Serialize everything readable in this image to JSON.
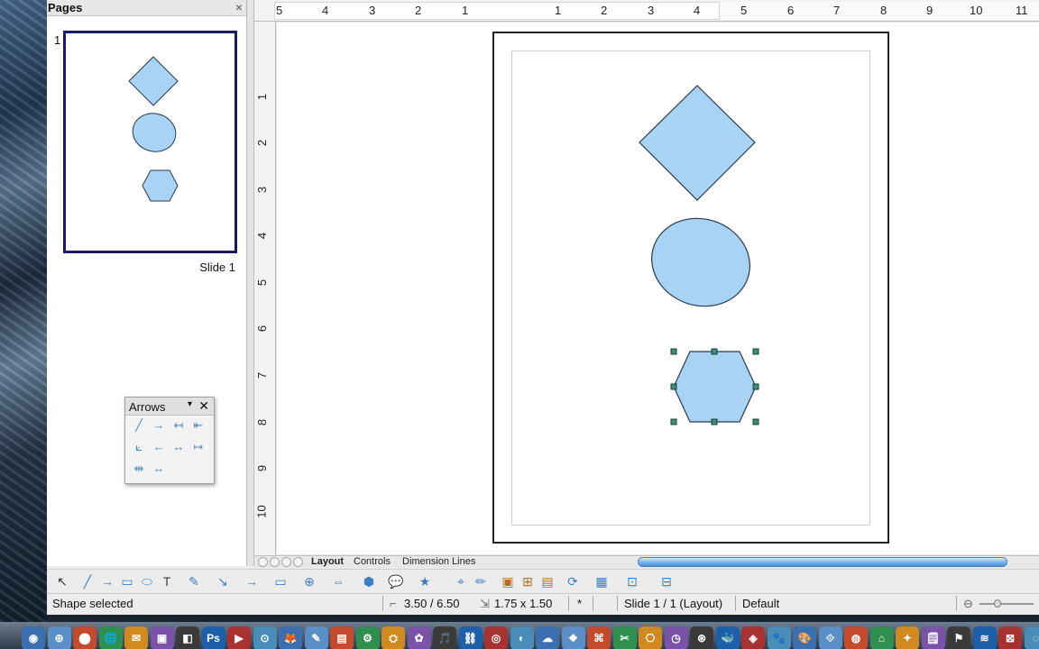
{
  "pages_panel": {
    "title": "Pages",
    "close": "×",
    "slide_number": "1",
    "slide_label": "Slide 1"
  },
  "rulers": {
    "horizontal": [
      "5",
      "4",
      "3",
      "2",
      "1",
      "1",
      "2",
      "3",
      "4",
      "5",
      "6",
      "7",
      "8",
      "9",
      "10",
      "11"
    ],
    "vertical": [
      "1",
      "2",
      "3",
      "4",
      "5",
      "6",
      "7",
      "8",
      "9",
      "10"
    ]
  },
  "tabs": [
    {
      "label": "Layout",
      "active": true
    },
    {
      "label": "Controls",
      "active": false
    },
    {
      "label": "Dimension Lines",
      "active": false
    }
  ],
  "arrows_toolbar": {
    "title": "Arrows",
    "menu": "▾",
    "close": "✕",
    "items": [
      "╱",
      "→",
      "↤",
      "⇤",
      "⟀",
      "←",
      "↔",
      "↦",
      "⇹",
      "↔"
    ]
  },
  "toolbar": {
    "items": [
      "↖",
      "╱",
      "→",
      "▭",
      "⬭",
      "T",
      "✎",
      "↘",
      "→",
      "▭",
      "⊕",
      "⇔",
      "⬢",
      "💬",
      "★",
      "⌖",
      "✏",
      "▣",
      "⊞",
      "▤",
      "⟳",
      "▦",
      "⊡",
      "⊟"
    ]
  },
  "status": {
    "message": "Shape selected",
    "position": "3.50 / 6.50",
    "size": "1.75 x 1.50",
    "modified": "*",
    "slide": "Slide 1 / 1 (Layout)",
    "master": "Default"
  },
  "colors": {
    "shape_fill": "#a9d3f5",
    "shape_stroke": "#2a3a4a",
    "thumb_border": "#1a1a66",
    "scroll": "#4a8fd8"
  },
  "dock": {
    "items": [
      "◉",
      "⊕",
      "⬤",
      "🌐",
      "✉",
      "▣",
      "◧",
      "Ps",
      "▶",
      "⊙",
      "🦊",
      "✎",
      "▤",
      "⚙",
      "⛭",
      "✿",
      "🎵",
      "⛓",
      "◎",
      "◐",
      "☁",
      "❖",
      "⌘",
      "✂",
      "⎔",
      "◷",
      "⊛",
      "🐳",
      "◈",
      "🐾",
      "🎨",
      "⟐",
      "◍",
      "⌂",
      "✦",
      "🗒",
      "⚑",
      "≋",
      "⊠",
      "◌"
    ]
  }
}
